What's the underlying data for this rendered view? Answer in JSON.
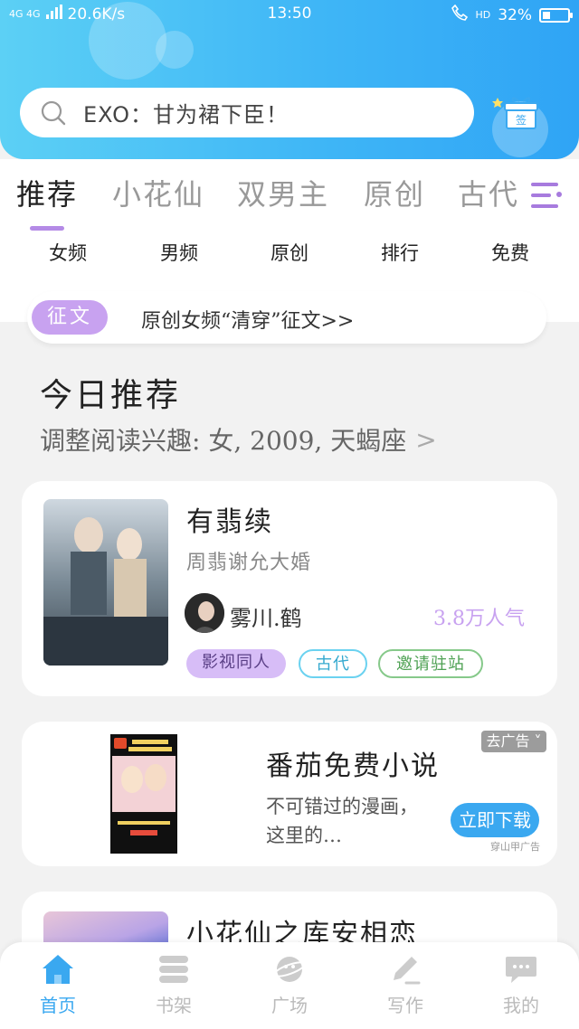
{
  "status_bar": {
    "network": "4G 4G",
    "speed": "20.6K/s",
    "time": "13:50",
    "hd": "HD",
    "battery": "32%",
    "battery_level": 0.32
  },
  "search": {
    "placeholder": "EXO：甘为裙下臣！"
  },
  "signin": {
    "label": "签"
  },
  "tabs": [
    "推荐",
    "小花仙",
    "双男主",
    "原创",
    "古代"
  ],
  "active_tab": "推荐",
  "subnav": [
    "女频",
    "男频",
    "原创",
    "排行",
    "免费"
  ],
  "contest": {
    "badge": "征文",
    "text": "原创女频“清穿”征文>>"
  },
  "recommend": {
    "title": "今日推荐",
    "subtitle": "调整阅读兴趣: 女, 2009, 天蝎座",
    "chevron": ">"
  },
  "book": {
    "title": "有翡续",
    "description": "周翡谢允大婚",
    "author": "雾川.鹤",
    "popularity": "3.8万人气",
    "tags": [
      "影视同人",
      "古代",
      "邀请驻站"
    ]
  },
  "ad": {
    "title": "番茄免费小说",
    "description": "不可错过的漫画，这里的…",
    "close_label": "去广告",
    "download_label": "立即下载",
    "source": "穿山甲广告"
  },
  "book2": {
    "title": "小花仙之库安相恋"
  },
  "bottom_nav": [
    "首页",
    "书架",
    "广场",
    "写作",
    "我的"
  ],
  "colors": {
    "header_blue": "#3fb6f6",
    "accent_purple": "#c8a2f0",
    "nav_active": "#3aa8f0"
  }
}
